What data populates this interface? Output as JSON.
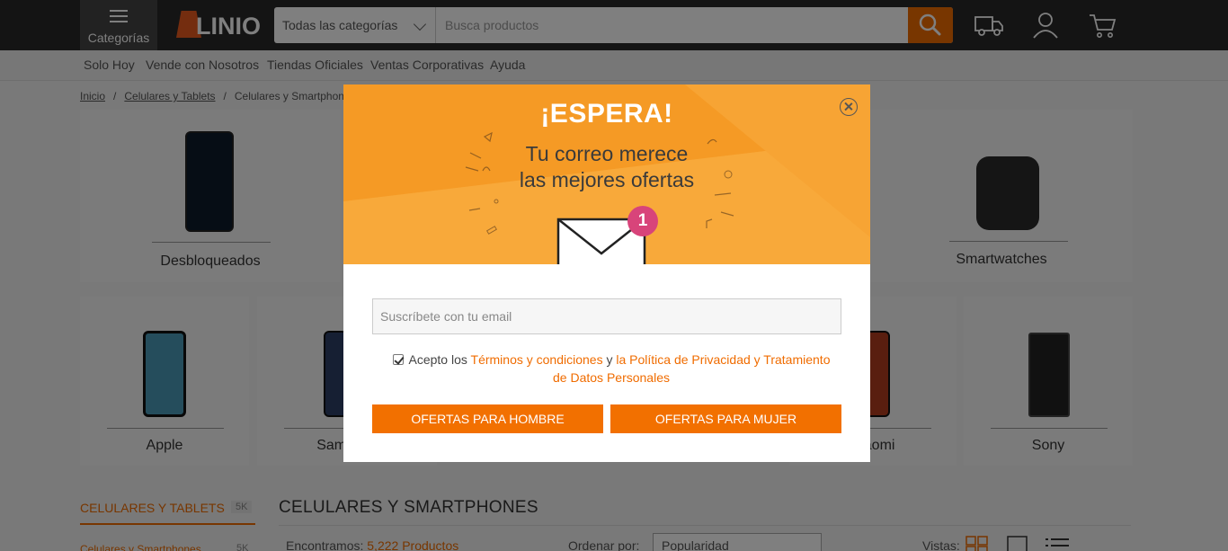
{
  "header": {
    "categories_label": "Categorías",
    "logo_text": "LINIO",
    "category_select": "Todas las categorías",
    "search_placeholder": "Busca productos"
  },
  "subnav": [
    "Solo Hoy",
    "Vende con Nosotros",
    "Tiendas Oficiales",
    "Ventas Corporativas",
    "Ayuda"
  ],
  "breadcrumb": [
    "Inicio",
    "Celulares y Tablets",
    "Celulares y Smartphones"
  ],
  "top_categories": {
    "left": "Desbloqueados",
    "right": "Smartwatches"
  },
  "brands": [
    "Apple",
    "Samsung",
    "Xiaomi",
    "Sony"
  ],
  "sidebar": {
    "title": "CELULARES Y TABLETS",
    "title_count": "5K",
    "sub_item": "Celulares y Smartphones",
    "sub_count": "5K"
  },
  "listing": {
    "title": "CELULARES Y SMARTPHONES",
    "found_prefix": "Encontramos:",
    "found_count": "5,222 Productos",
    "order_label": "Ordenar por:",
    "order_value": "Popularidad",
    "views_label": "Vistas:"
  },
  "modal": {
    "headline": "¡ESPERA!",
    "sub_line1": "Tu correo merece",
    "sub_line2": "las mejores ofertas",
    "badge": "1",
    "email_placeholder": "Suscríbete con tu email",
    "consent_prefix": "Acepto los",
    "terms_link": "Términos y condiciones",
    "consent_and": "y",
    "privacy_link": "la Política de Privacidad y Tratamiento de Datos Personales",
    "men_button": "OFERTAS PARA HOMBRE",
    "women_button": "OFERTAS PARA MUJER"
  },
  "colors": {
    "accent": "#f06c00",
    "banner": "#f7a030",
    "badge": "#d8447a",
    "topbar": "#292929"
  }
}
